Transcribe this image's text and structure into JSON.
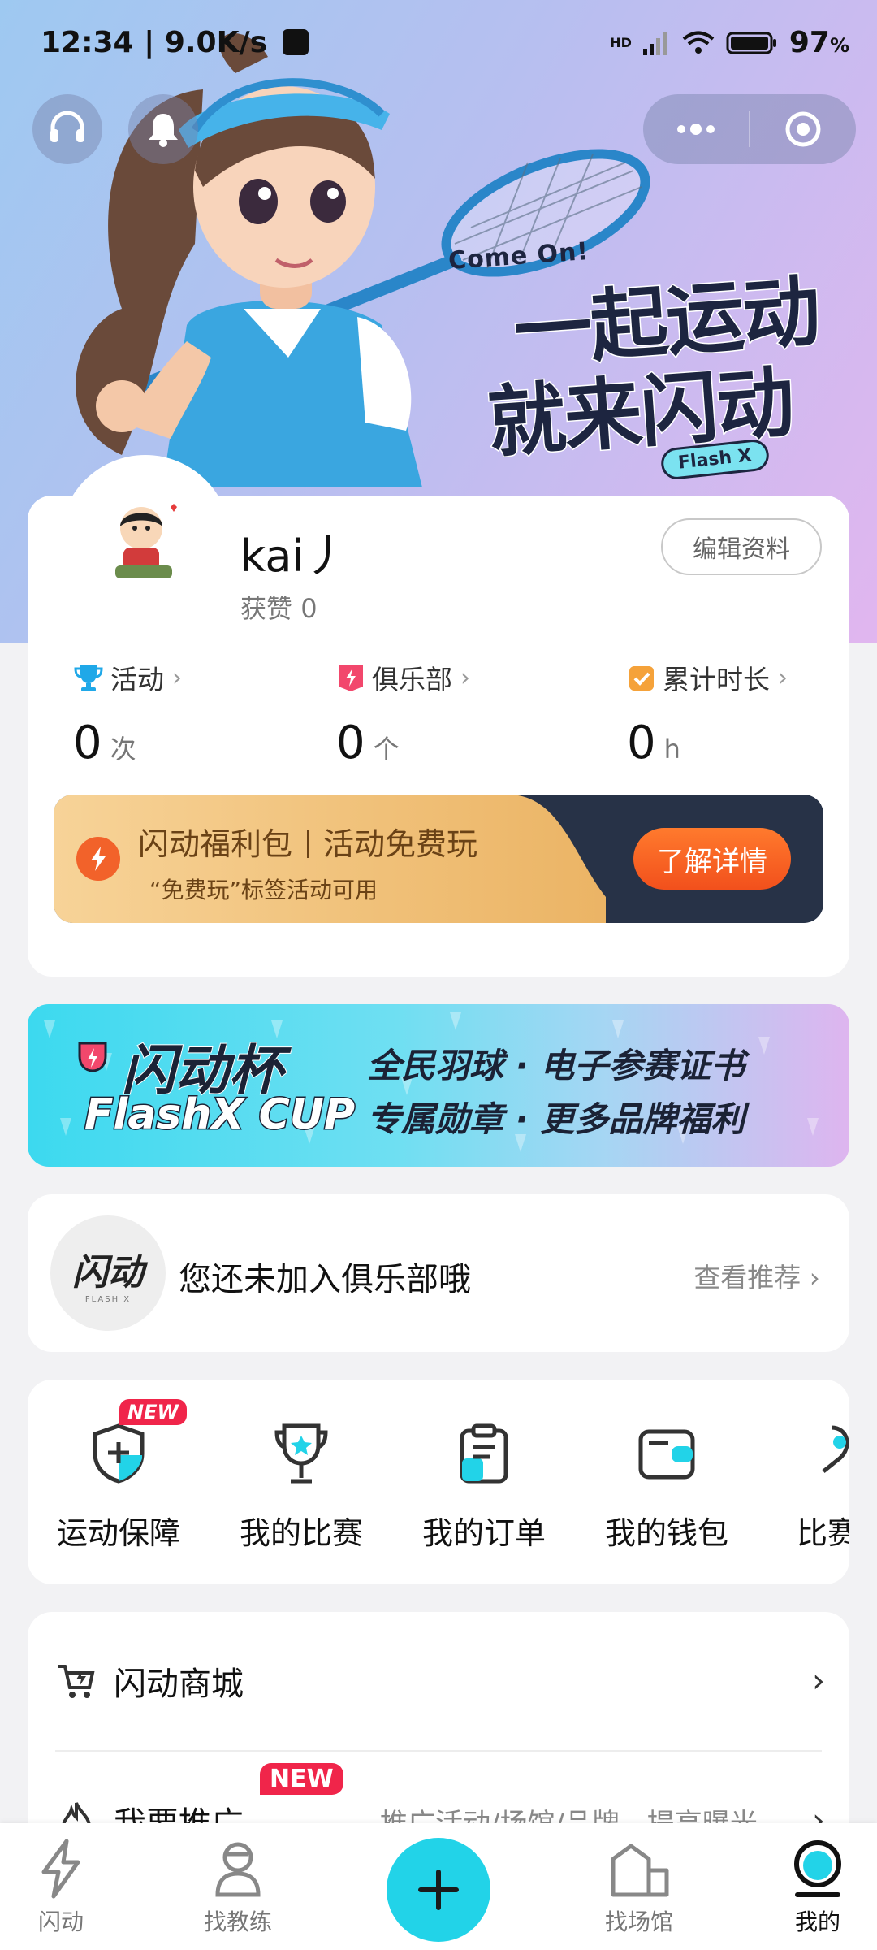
{
  "status": {
    "time": "12:34",
    "speed": "9.0K/s",
    "battery": "97",
    "battery_unit": "%",
    "net": "HD"
  },
  "hero": {
    "slogan_en": "Come On!",
    "slogan_line1": "一起运动",
    "slogan_line2": "就来闪动",
    "badge": "Flash X"
  },
  "profile": {
    "username": "kai丿",
    "likes_label": "获赞",
    "likes_value": "0",
    "edit_label": "编辑资料",
    "stats": [
      {
        "label": "活动",
        "value": "0",
        "unit": "次",
        "icon": "trophy-icon"
      },
      {
        "label": "俱乐部",
        "value": "0",
        "unit": "个",
        "icon": "club-icon"
      },
      {
        "label": "累计时长",
        "value": "0",
        "unit": "h",
        "icon": "checklist-icon"
      }
    ]
  },
  "welfare": {
    "title_a": "闪动福利包",
    "title_b": "活动免费玩",
    "subtitle": "“免费玩”标签活动可用",
    "button": "了解详情"
  },
  "banner": {
    "logo_cn": "闪动杯",
    "logo_en": "FlashX CUP",
    "line1": "全民羽球 · 电子参赛证书",
    "line2": "专属勋章 · 更多品牌福利"
  },
  "club": {
    "logo_text": "闪动",
    "logo_sub": "FLASH X",
    "message": "您还未加入俱乐部哦",
    "link": "查看推荐"
  },
  "shortcuts": [
    {
      "label": "运动保障",
      "icon": "shield-plus-icon",
      "tag": "NEW"
    },
    {
      "label": "我的比赛",
      "icon": "cup-icon"
    },
    {
      "label": "我的订单",
      "icon": "clipboard-icon"
    },
    {
      "label": "我的钱包",
      "icon": "wallet-icon"
    },
    {
      "label": "比赛",
      "icon": "match-icon"
    }
  ],
  "menu": [
    {
      "label": "闪动商城",
      "icon": "cart-icon"
    },
    {
      "label": "我要推广",
      "icon": "fire-icon",
      "tag": "NEW",
      "desc": "推广活动/场馆/品牌，提高曝光"
    }
  ],
  "tabs": [
    {
      "label": "闪动",
      "icon": "bolt-icon"
    },
    {
      "label": "找教练",
      "icon": "coach-icon"
    },
    {
      "label": "",
      "icon": "plus-icon"
    },
    {
      "label": "找场馆",
      "icon": "venue-icon"
    },
    {
      "label": "我的",
      "icon": "profile-icon",
      "active": true
    }
  ],
  "colors": {
    "accent": "#22d3e8",
    "orange": "#f2501c",
    "new_tag": "#f0254a"
  }
}
